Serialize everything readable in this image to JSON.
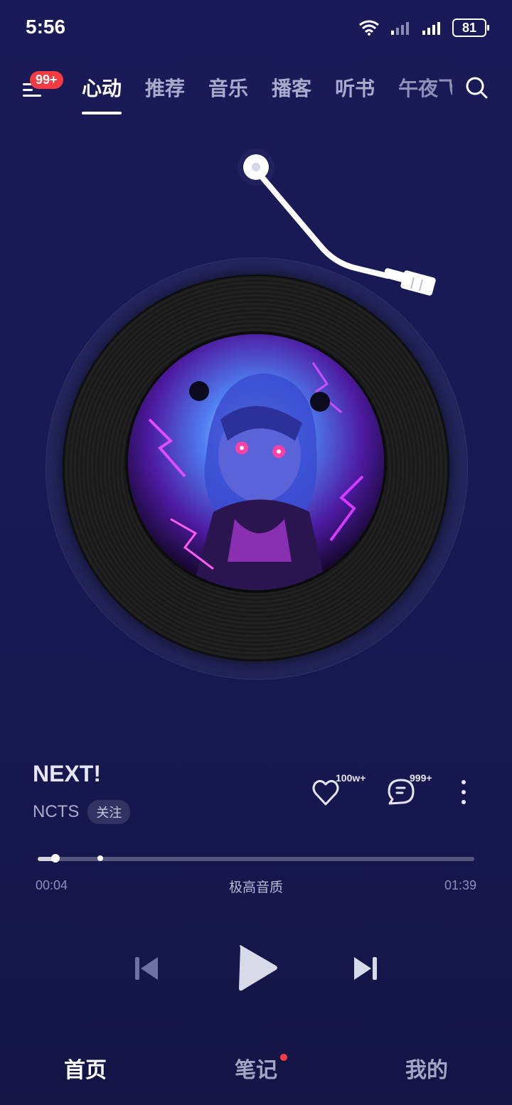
{
  "status_bar": {
    "time": "5:56",
    "battery": "81"
  },
  "top_tabs": {
    "badge": "99+",
    "items": [
      {
        "label": "心动"
      },
      {
        "label": "推荐"
      },
      {
        "label": "音乐"
      },
      {
        "label": "播客"
      },
      {
        "label": "听书"
      },
      {
        "label": "午夜飞"
      }
    ]
  },
  "song": {
    "title": "NEXT!",
    "artist": "NCTS",
    "follow_label": "关注",
    "likes": "100w+",
    "comments": "999+"
  },
  "progress": {
    "current": "00:04",
    "total": "01:39",
    "quality": "极高音质",
    "played_fraction": 0.04
  },
  "bottom_nav": {
    "home": "首页",
    "notes": "笔记",
    "mine": "我的"
  },
  "colors": {
    "background": "#191a57",
    "badge": "#f23b43"
  }
}
